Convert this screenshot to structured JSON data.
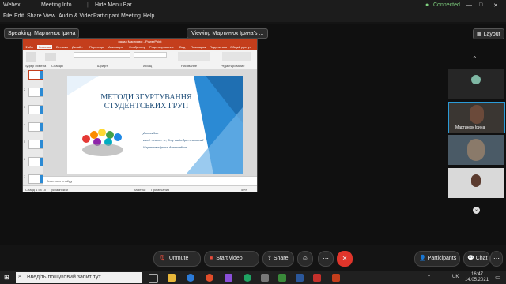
{
  "titlebar": {
    "app": "Webex",
    "tab": "Meeting Info",
    "hide_menu": "Hide Menu Bar",
    "status": "Connected"
  },
  "menu": [
    "File",
    "Edit",
    "Share",
    "View",
    "Audio & Video",
    "Participant",
    "Meeting",
    "Help"
  ],
  "speaking": "Speaking: Мартинюк Ірина",
  "viewing": "Viewing Мартинюк Ірина's ...",
  "layout": "Layout",
  "ppt": {
    "window_title": "насил Мартинюк - PowerPoint",
    "tabs": [
      "Файл",
      "Главная",
      "Вставка",
      "Дизайн",
      "Переходы",
      "Анимация",
      "Слайд-шоу",
      "Рецензирование",
      "Вид",
      "Помощник",
      "Поделиться",
      "Общий доступ"
    ],
    "ribbon_groups": [
      "Буфер обмена",
      "Слайды",
      "Шрифт",
      "Абзац",
      "Рисование",
      "Редактирование"
    ],
    "slide_title": "МЕТОДИ ЗГУРТУВАННЯ СТУДЕНТСЬКИХ ГРУП",
    "doer_lines": [
      "Доповідач:",
      "канд. психол. н., доц. кафедри психології",
      "Мартинюк Ірина Анатоліївна"
    ],
    "notes": "Заметки к слайду",
    "status_left": "Слайд 1 из 10",
    "status_lang": "украинский",
    "status_notes": "Заметки",
    "status_comments": "Примечания",
    "zoom": "50%"
  },
  "participants": [
    {
      "name": "",
      "color": "#7fb8a4"
    },
    {
      "name": "Мартинюк Ірина",
      "color": "#6b4a3a"
    },
    {
      "name": "",
      "color": "#8a7a6a"
    },
    {
      "name": "",
      "color": "#d9d9d9"
    }
  ],
  "controls": {
    "unmute": "Unmute",
    "start_video": "Start video",
    "share": "Share",
    "participants": "Participants",
    "chat": "Chat"
  },
  "taskbar": {
    "search": "Введіть пошуковий запит тут",
    "lang": "UK",
    "time": "16:47",
    "date": "14.05.2021"
  }
}
